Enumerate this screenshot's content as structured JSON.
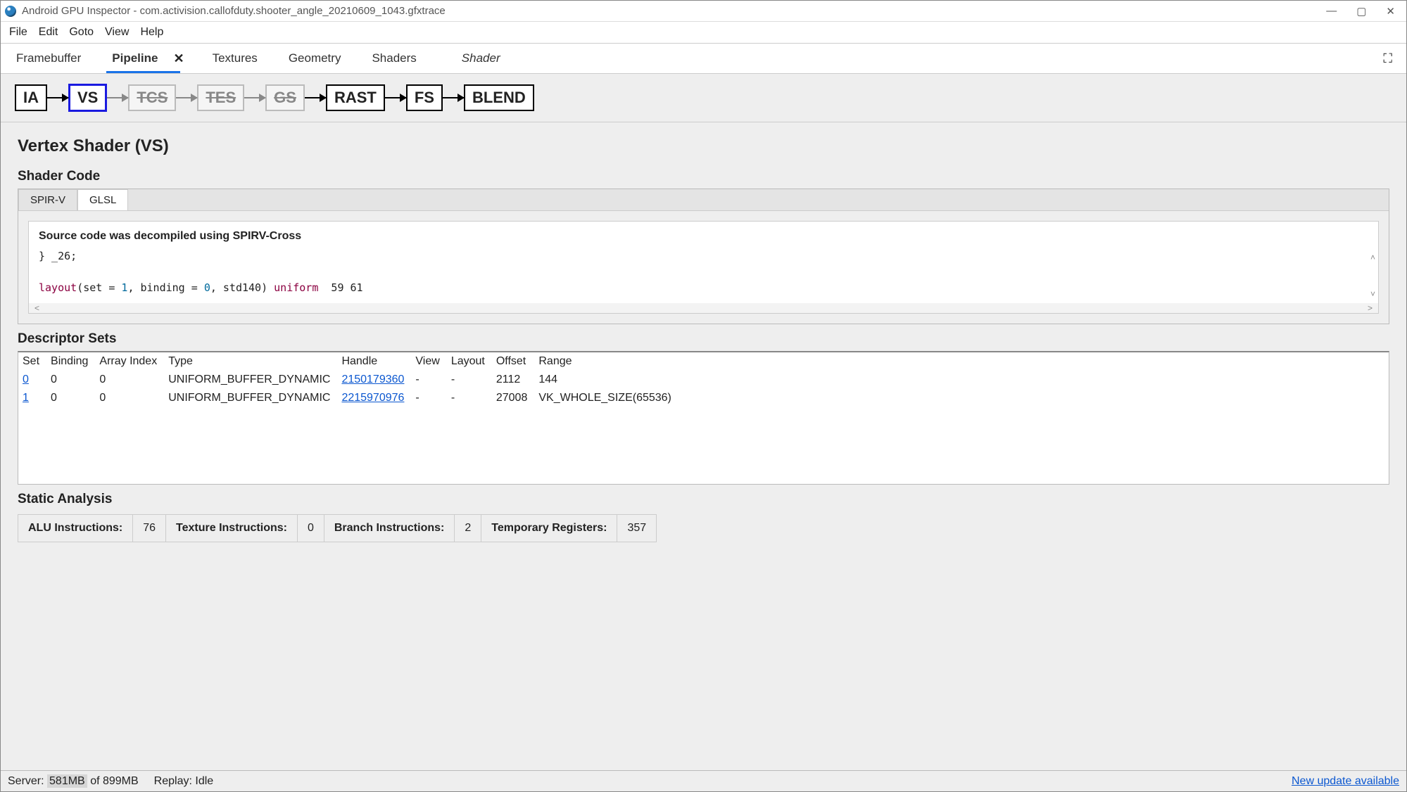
{
  "window": {
    "title": "Android GPU Inspector - com.activision.callofduty.shooter_angle_20210609_1043.gfxtrace"
  },
  "menu": [
    "File",
    "Edit",
    "Goto",
    "View",
    "Help"
  ],
  "tabs": {
    "items": [
      "Framebuffer",
      "Pipeline",
      "Textures",
      "Geometry",
      "Shaders"
    ],
    "active": "Pipeline",
    "secondary": "Shader"
  },
  "pipeline": {
    "stages": [
      {
        "label": "IA",
        "state": "normal"
      },
      {
        "label": "VS",
        "state": "selected"
      },
      {
        "label": "TCS",
        "state": "disabled"
      },
      {
        "label": "TES",
        "state": "disabled"
      },
      {
        "label": "GS",
        "state": "disabled"
      },
      {
        "label": "RAST",
        "state": "normal"
      },
      {
        "label": "FS",
        "state": "normal"
      },
      {
        "label": "BLEND",
        "state": "normal"
      }
    ]
  },
  "page_title": "Vertex Shader (VS)",
  "shader_code": {
    "section_title": "Shader Code",
    "tabs": [
      "SPIR-V",
      "GLSL"
    ],
    "active_tab": "GLSL",
    "decompile_note": "Source code was decompiled using SPIRV-Cross",
    "line1_text": "} _26;",
    "line2_prefix": "layout",
    "line2_open": "(set = ",
    "line2_set": "1",
    "line2_mid": ", binding = ",
    "line2_bind": "0",
    "line2_fmt": ", std140) ",
    "line2_uniform": "uniform",
    "line2_tail": "  59 61"
  },
  "descriptor_sets": {
    "section_title": "Descriptor Sets",
    "columns": [
      "Set",
      "Binding",
      "Array Index",
      "Type",
      "Handle",
      "View",
      "Layout",
      "Offset",
      "Range"
    ],
    "rows": [
      {
        "set": "0",
        "binding": "0",
        "array_index": "0",
        "type": "UNIFORM_BUFFER_DYNAMIC",
        "handle": "2150179360",
        "view": "-",
        "layout": "-",
        "offset": "2112",
        "range": "144"
      },
      {
        "set": "1",
        "binding": "0",
        "array_index": "0",
        "type": "UNIFORM_BUFFER_DYNAMIC",
        "handle": "2215970976",
        "view": "-",
        "layout": "-",
        "offset": "27008",
        "range": "VK_WHOLE_SIZE(65536)"
      }
    ]
  },
  "static_analysis": {
    "section_title": "Static Analysis",
    "stats": [
      {
        "label": "ALU Instructions:",
        "value": "76"
      },
      {
        "label": "Texture Instructions:",
        "value": "0"
      },
      {
        "label": "Branch Instructions:",
        "value": "2"
      },
      {
        "label": "Temporary Registers:",
        "value": "357"
      }
    ]
  },
  "statusbar": {
    "server_label": "Server:",
    "server_used": "581MB",
    "server_total": "of 899MB",
    "replay_label": "Replay:",
    "replay_state": "Idle",
    "update_link": "New update available"
  }
}
